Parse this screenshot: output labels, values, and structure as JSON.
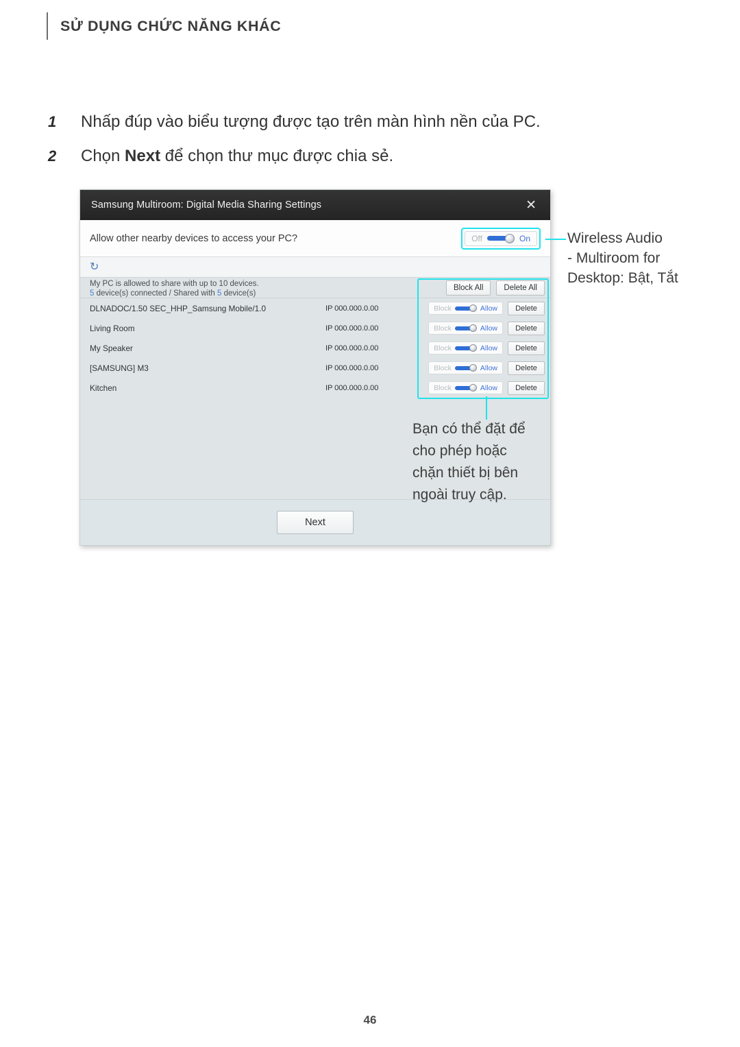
{
  "page": {
    "header_title": "SỬ DỤNG CHỨC NĂNG KHÁC",
    "number": "46"
  },
  "steps": [
    {
      "num": "1",
      "text_before": "Nhấp đúp vào biểu tượng được tạo trên màn hình nền của PC.",
      "bold": "",
      "text_after": ""
    },
    {
      "num": "2",
      "text_before": "Chọn ",
      "bold": "Next",
      "text_after": " để chọn thư mục được chia sẻ."
    }
  ],
  "dialog": {
    "title": "Samsung Multiroom: Digital Media Sharing Settings",
    "close_label": "✕",
    "prompt": "Allow other nearby devices to access your PC?",
    "master_toggle": {
      "off_label": "Off",
      "on_label": "On",
      "state": "On"
    },
    "refresh_icon": "↻",
    "info_line1": "My PC is allowed to share with up to 10 devices.",
    "info_connected_count": "5",
    "info_mid_text": " device(s) connected / Shared with ",
    "info_shared_count": "5",
    "info_tail_text": " device(s)",
    "bulk_buttons": {
      "block_all": "Block All",
      "delete_all": "Delete All"
    },
    "row_controls": {
      "block_label": "Block",
      "allow_label": "Allow",
      "delete_label": "Delete"
    },
    "devices": [
      {
        "name": "DLNADOC/1.50 SEC_HHP_Samsung Mobile/1.0",
        "ip": "IP 000.000.0.00",
        "state": "Allow"
      },
      {
        "name": "Living Room",
        "ip": "IP 000.000.0.00",
        "state": "Allow"
      },
      {
        "name": "My Speaker",
        "ip": "IP 000.000.0.00",
        "state": "Allow"
      },
      {
        "name": "[SAMSUNG] M3",
        "ip": "IP 000.000.0.00",
        "state": "Allow"
      },
      {
        "name": "Kitchen",
        "ip": "IP 000.000.0.00",
        "state": "Allow"
      }
    ],
    "next_button": "Next"
  },
  "callouts": {
    "toggle_note": "Wireless Audio - Multiroom for Desktop: Bật, Tắt",
    "toggle_note_line1": "Wireless Audio",
    "toggle_note_line2": "- Multiroom for",
    "toggle_note_line3": "Desktop: Bật, Tắt",
    "devices_note_line1": "Bạn có thể đặt để",
    "devices_note_line2": "cho phép hoặc",
    "devices_note_line3": "chặn thiết bị bên",
    "devices_note_line4": "ngoài truy cập."
  },
  "colors": {
    "highlight": "#22e2ec",
    "accent_blue": "#2f6fd6",
    "link_blue": "#3f72d8",
    "titlebar": "#2b2b2b",
    "dialog_body": "#dfe4e6"
  }
}
